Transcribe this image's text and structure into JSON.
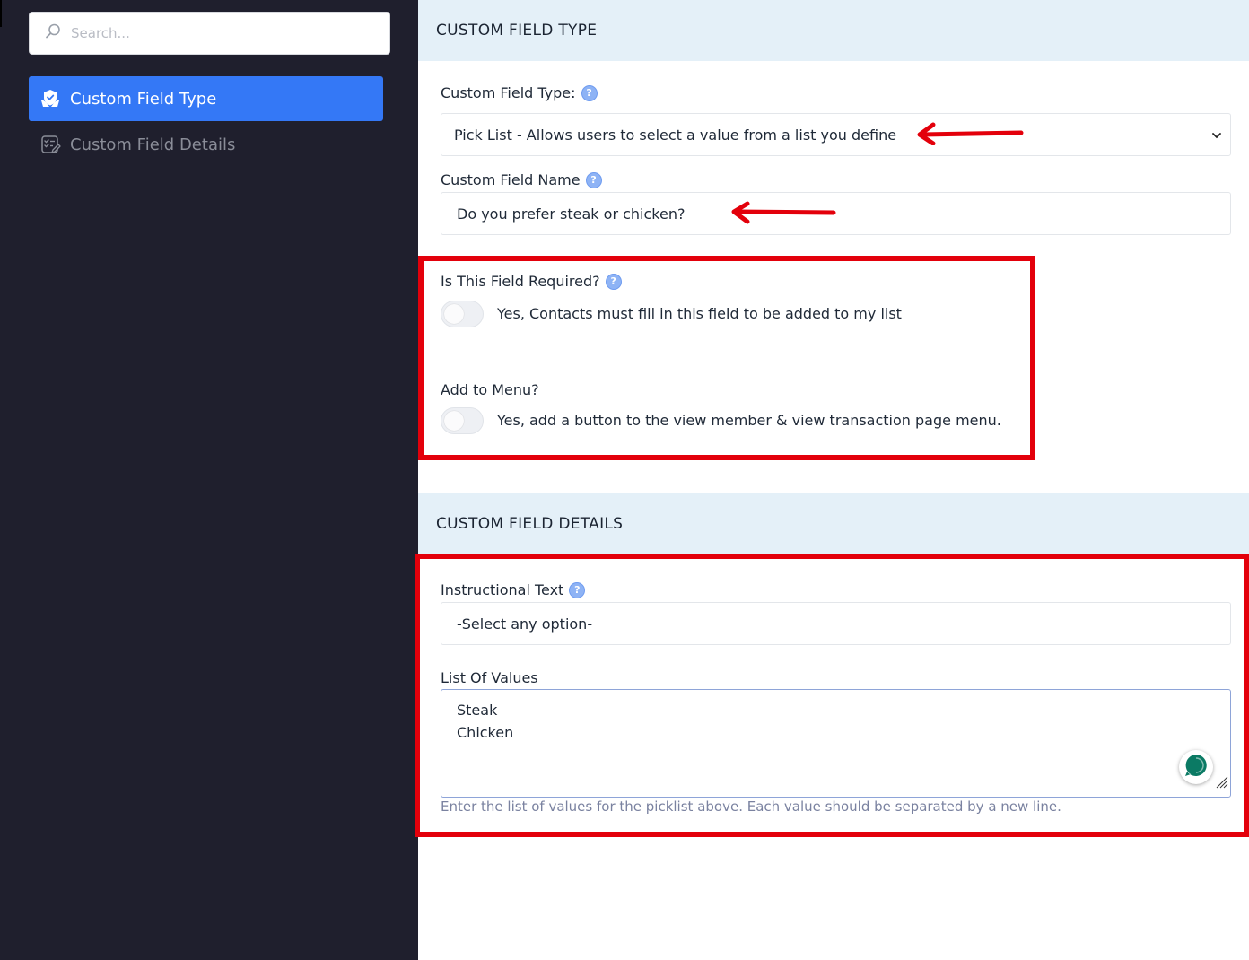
{
  "sidebar": {
    "search": {
      "placeholder": "Search..."
    },
    "items": [
      {
        "label": "Custom Field Type",
        "active": true,
        "icon": "hand-shield-icon"
      },
      {
        "label": "Custom Field Details",
        "active": false,
        "icon": "edit-list-icon"
      }
    ]
  },
  "section_type": {
    "header": "CUSTOM FIELD TYPE",
    "field_type_label": "Custom Field Type:",
    "field_type_value": "Pick List - Allows users to select a value from a list you define",
    "field_name_label": "Custom Field Name",
    "field_name_value": "Do you prefer steak or chicken?",
    "required_label": "Is This Field Required?",
    "required_text": "Yes, Contacts must fill in this field to be added to my list",
    "required_on": false,
    "menu_label": "Add to Menu?",
    "menu_text": "Yes, add a button to the view member & view transaction page menu.",
    "menu_on": false
  },
  "section_details": {
    "header": "CUSTOM FIELD DETAILS",
    "instructional_label": "Instructional Text",
    "instructional_value": "-Select any option-",
    "list_label": "List Of Values",
    "list_values": [
      "Steak",
      "Chicken"
    ],
    "list_help": "Enter the list of values for the picklist above. Each value should be separated by a new line."
  },
  "help_glyph": "?",
  "colors": {
    "sidebar_bg": "#1f1f2d",
    "accent": "#3478f6",
    "section_header_bg": "#e4f0f8",
    "annotation_red": "#e3000b",
    "chat_green": "#0b7a64"
  }
}
